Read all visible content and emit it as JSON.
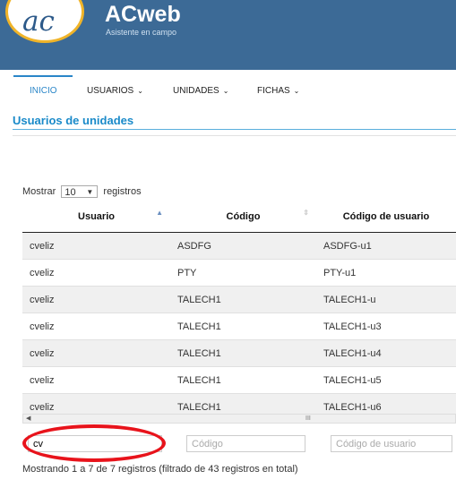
{
  "header": {
    "app_title": "ACweb",
    "app_subtitle": "Asistente en campo",
    "logo_text": "ac",
    "bg_color": "#3c6a96"
  },
  "nav": [
    {
      "label": "INICIO",
      "has_menu": false,
      "active": true
    },
    {
      "label": "USUARIOS",
      "has_menu": true,
      "active": false
    },
    {
      "label": "UNIDADES",
      "has_menu": true,
      "active": false
    },
    {
      "label": "FICHAS",
      "has_menu": true,
      "active": false
    }
  ],
  "nav_accent": "#2a86c8",
  "page_title": "Usuarios de unidades",
  "length_menu": {
    "before": "Mostrar",
    "value": "10",
    "after": "registros"
  },
  "table": {
    "columns": [
      "Usuario",
      "Código",
      "Código de usuario"
    ],
    "rows": [
      [
        "cveliz",
        "ASDFG",
        "ASDFG-u1"
      ],
      [
        "cveliz",
        "PTY",
        "PTY-u1"
      ],
      [
        "cveliz",
        "TALECH1",
        "TALECH1-u"
      ],
      [
        "cveliz",
        "TALECH1",
        "TALECH1-u3"
      ],
      [
        "cveliz",
        "TALECH1",
        "TALECH1-u4"
      ],
      [
        "cveliz",
        "TALECH1",
        "TALECH1-u5"
      ],
      [
        "cveliz",
        "TALECH1",
        "TALECH1-u6"
      ]
    ]
  },
  "scrollbar_grip": "III",
  "filters": [
    {
      "value": "cv",
      "placeholder": ""
    },
    {
      "value": "",
      "placeholder": "Código"
    },
    {
      "value": "",
      "placeholder": "Código de usuario"
    }
  ],
  "info_text": "Mostrando 1 a 7 de 7 registros (filtrado de 43 registros en total)",
  "highlight_color": "#e8131b"
}
